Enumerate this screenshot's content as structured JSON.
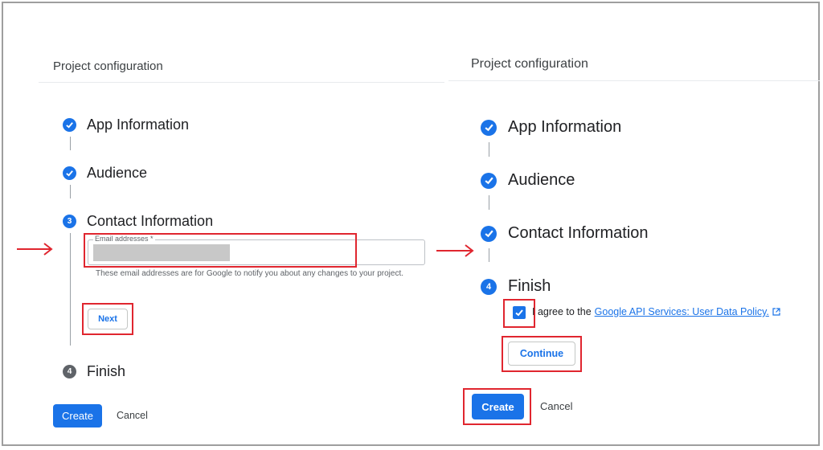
{
  "left": {
    "title": "Project configuration",
    "steps": [
      {
        "label": "App Information",
        "state": "done"
      },
      {
        "label": "Audience",
        "state": "done"
      },
      {
        "label": "Contact Information",
        "state": "active",
        "number": "3"
      },
      {
        "label": "Finish",
        "state": "pending",
        "number": "4"
      }
    ],
    "email_field": {
      "legend": "Email addresses *"
    },
    "helper_text": "These email addresses are for Google to notify you about any changes to your project.",
    "next_label": "Next",
    "create_label": "Create",
    "cancel_label": "Cancel"
  },
  "right": {
    "title": "Project configuration",
    "steps": [
      {
        "label": "App Information",
        "state": "done"
      },
      {
        "label": "Audience",
        "state": "done"
      },
      {
        "label": "Contact Information",
        "state": "done"
      },
      {
        "label": "Finish",
        "state": "active",
        "number": "4"
      }
    ],
    "agree_text": "I agree to the",
    "agree_link": "Google API Services: User Data Policy.",
    "continue_label": "Continue",
    "create_label": "Create",
    "cancel_label": "Cancel"
  },
  "colors": {
    "accent": "#1a73e8",
    "highlight": "#e0262f",
    "pending": "#5f6368"
  },
  "icons": {
    "done": "check-icon",
    "arrow": "right-arrow-icon",
    "external": "external-link-icon"
  }
}
